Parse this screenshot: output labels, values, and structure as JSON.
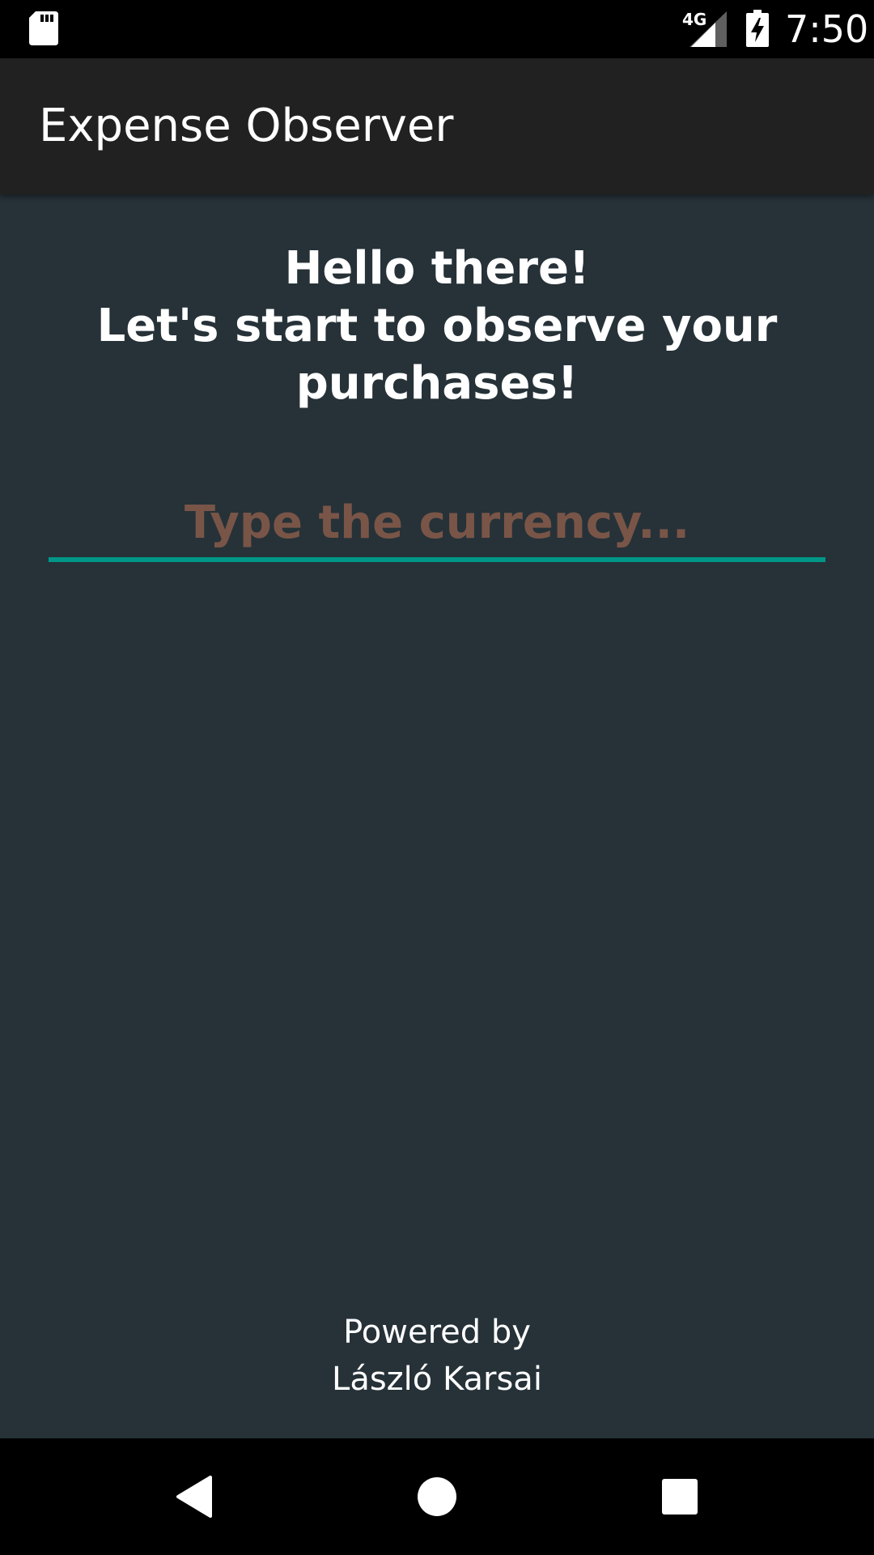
{
  "status_bar": {
    "network_type": "4G",
    "time": "7:50",
    "icons": [
      "sd-card-icon",
      "signal-icon",
      "battery-charging-icon"
    ]
  },
  "app_bar": {
    "title": "Expense Observer"
  },
  "greeting": {
    "lines": [
      "Hello there!",
      "Let's start to observe your",
      "purchases!"
    ]
  },
  "currency_input": {
    "value": "",
    "placeholder": "Type the currency..."
  },
  "footer": {
    "line1": "Powered by",
    "line2": "László Karsai"
  },
  "nav_bar": {
    "icons": [
      "back-icon",
      "home-icon",
      "recents-icon"
    ]
  },
  "colors": {
    "background": "#263238",
    "app_bar": "#212121",
    "accent": "#009688",
    "placeholder": "#795548",
    "text": "#ffffff"
  }
}
